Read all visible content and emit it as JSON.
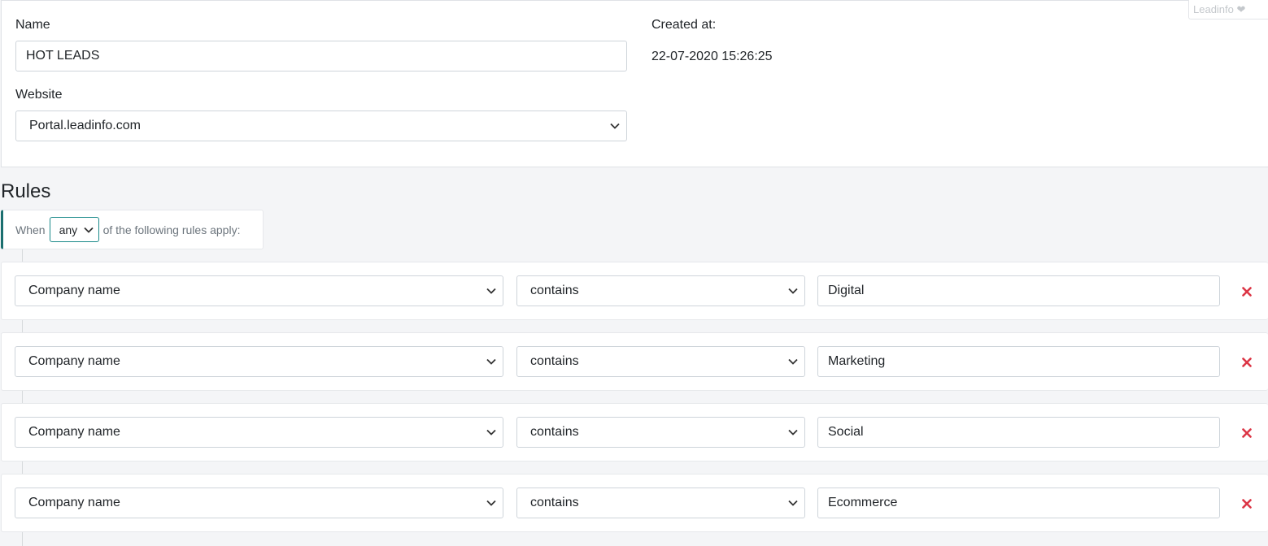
{
  "badge": {
    "text": "Leadinfo ❤"
  },
  "form": {
    "name_label": "Name",
    "name_value": "HOT LEADS",
    "website_label": "Website",
    "website_value": "Portal.leadinfo.com",
    "created_label": "Created at:",
    "created_value": "22-07-2020 15:26:25"
  },
  "rules": {
    "title": "Rules",
    "when_prefix": "When",
    "match_value": "any",
    "when_suffix": "of the following rules apply:",
    "items": [
      {
        "field": "Company name",
        "operator": "contains",
        "value": "Digital"
      },
      {
        "field": "Company name",
        "operator": "contains",
        "value": "Marketing"
      },
      {
        "field": "Company name",
        "operator": "contains",
        "value": "Social"
      },
      {
        "field": "Company name",
        "operator": "contains",
        "value": "Ecommerce"
      }
    ]
  },
  "colors": {
    "delete": "#dc3545",
    "accent": "#1b6f6f"
  },
  "icons": {
    "select_arrow": "chevron-down-icon",
    "delete": "close-icon"
  }
}
